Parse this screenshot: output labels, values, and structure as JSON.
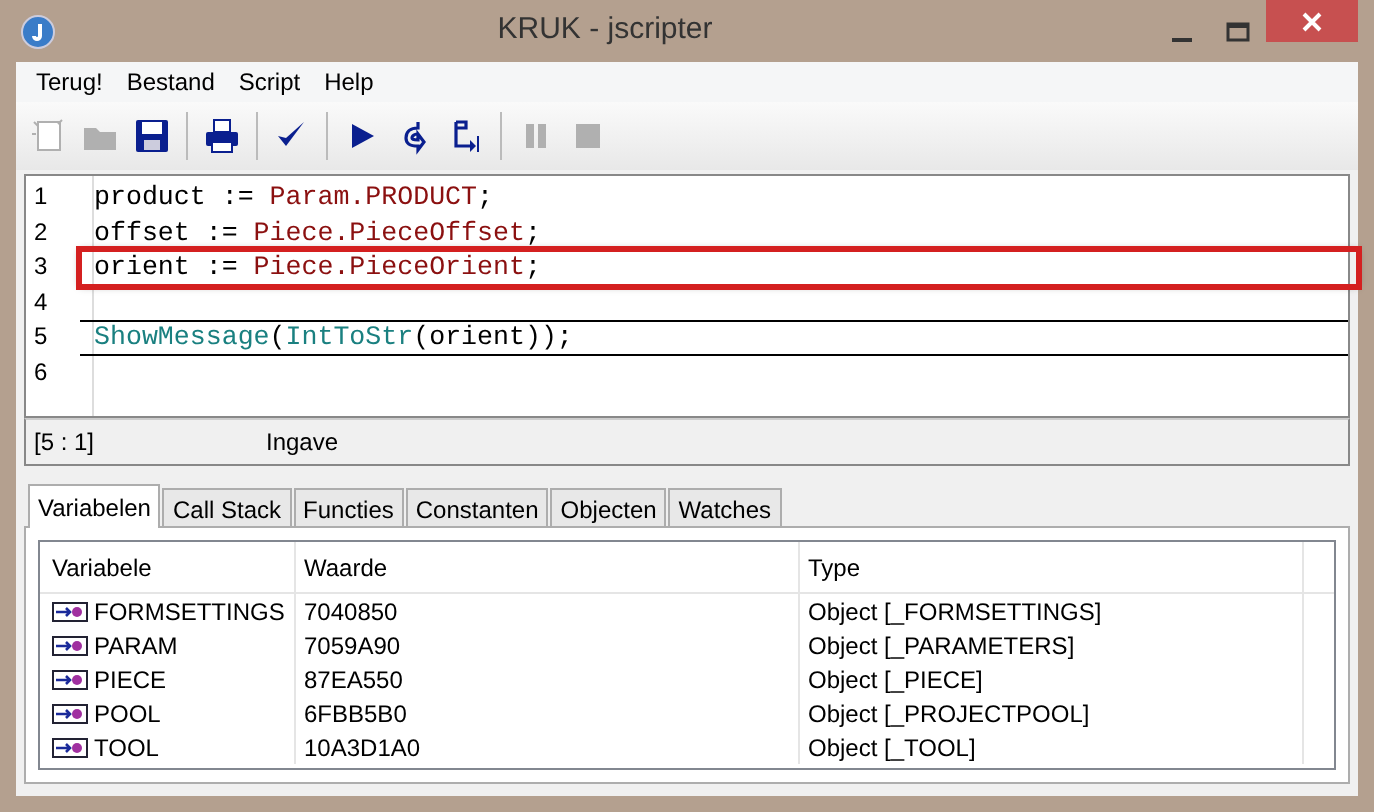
{
  "window": {
    "title": "KRUK - jscripter"
  },
  "menu": [
    "Terug!",
    "Bestand",
    "Script",
    "Help"
  ],
  "toolbar": [
    {
      "kind": "new",
      "disabled": true
    },
    {
      "kind": "open",
      "disabled": true
    },
    {
      "kind": "save",
      "disabled": false
    },
    {
      "kind": "sep"
    },
    {
      "kind": "print",
      "disabled": false
    },
    {
      "kind": "sep"
    },
    {
      "kind": "check",
      "disabled": false
    },
    {
      "kind": "sep"
    },
    {
      "kind": "run",
      "disabled": false
    },
    {
      "kind": "step-into",
      "disabled": false
    },
    {
      "kind": "step-over",
      "disabled": false
    },
    {
      "kind": "sep"
    },
    {
      "kind": "pause",
      "disabled": true
    },
    {
      "kind": "stop",
      "disabled": true
    }
  ],
  "editor": {
    "lines": [
      {
        "number": "1",
        "current": false,
        "highlighted": false,
        "tokens": [
          {
            "text": "product := ",
            "kind": "plain"
          },
          {
            "text": "Param.PRODUCT",
            "kind": "ident"
          },
          {
            "text": ";",
            "kind": "plain"
          }
        ]
      },
      {
        "number": "2",
        "current": false,
        "highlighted": false,
        "tokens": [
          {
            "text": "offset := ",
            "kind": "plain"
          },
          {
            "text": "Piece.PieceOffset",
            "kind": "ident"
          },
          {
            "text": ";",
            "kind": "plain"
          }
        ]
      },
      {
        "number": "3",
        "current": false,
        "highlighted": true,
        "tokens": [
          {
            "text": "orient := ",
            "kind": "plain"
          },
          {
            "text": "Piece.PieceOrient",
            "kind": "ident"
          },
          {
            "text": ";",
            "kind": "plain"
          }
        ]
      },
      {
        "number": "4",
        "current": false,
        "highlighted": false
      },
      {
        "number": "5",
        "current": true,
        "highlighted": false,
        "tokens": [
          {
            "text": "ShowMessage",
            "kind": "func"
          },
          {
            "text": "(",
            "kind": "plain"
          },
          {
            "text": "IntToStr",
            "kind": "func"
          },
          {
            "text": "(orient));",
            "kind": "plain"
          }
        ]
      },
      {
        "number": "6",
        "current": false,
        "highlighted": false
      }
    ],
    "position": "[5 : 1]",
    "mode": "Ingave"
  },
  "tabs": [
    {
      "label": "Variabelen",
      "selected": true
    },
    {
      "label": "Call Stack",
      "selected": false
    },
    {
      "label": "Functies",
      "selected": false
    },
    {
      "label": "Constanten",
      "selected": false
    },
    {
      "label": "Objecten",
      "selected": false
    },
    {
      "label": "Watches",
      "selected": false
    }
  ],
  "table": {
    "columns": [
      "Variabele",
      "Waarde",
      "Type"
    ],
    "rows": [
      [
        "FORMSETTINGS",
        "7040850",
        "Object [_FORMSETTINGS]"
      ],
      [
        "PARAM",
        "7059A90",
        "Object [_PARAMETERS]"
      ],
      [
        "PIECE",
        "87EA550",
        "Object [_PIECE]"
      ],
      [
        "POOL",
        "6FBB5B0",
        "Object [_PROJECTPOOL]"
      ],
      [
        "TOOL",
        "10A3D1A0",
        "Object [_TOOL]"
      ]
    ]
  }
}
